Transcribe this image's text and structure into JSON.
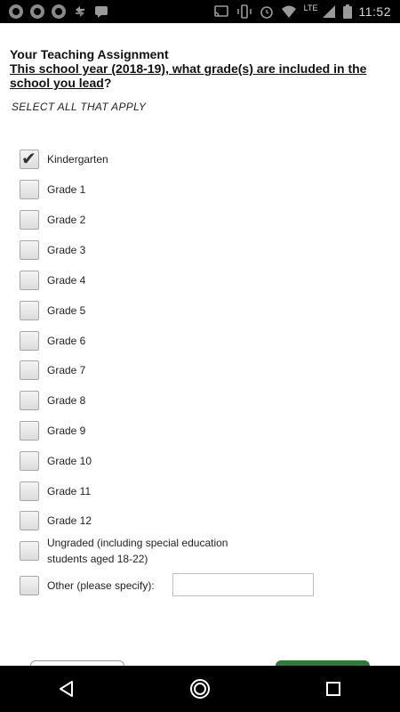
{
  "status_bar": {
    "network_label": "LTE",
    "time": "11:52"
  },
  "survey": {
    "section_title": "Your Teaching Assignment",
    "question_part1": "This school year (2018-19), what grade(s) are included in the school you lead",
    "question_mark": "?",
    "instruction": "SELECT ALL THAT APPLY",
    "options": [
      {
        "label": "Kindergarten",
        "checked": true
      },
      {
        "label": "Grade 1",
        "checked": false
      },
      {
        "label": "Grade 2",
        "checked": false
      },
      {
        "label": "Grade 3",
        "checked": false
      },
      {
        "label": "Grade 4",
        "checked": false
      },
      {
        "label": "Grade 5",
        "checked": false
      },
      {
        "label": "Grade 6",
        "checked": false
      },
      {
        "label": "Grade 7",
        "checked": false
      },
      {
        "label": "Grade 8",
        "checked": false
      },
      {
        "label": "Grade 9",
        "checked": false
      },
      {
        "label": "Grade 10",
        "checked": false
      },
      {
        "label": "Grade 11",
        "checked": false
      },
      {
        "label": "Grade 12",
        "checked": false
      },
      {
        "label": "Ungraded (including special education students aged 18-22)",
        "checked": false
      },
      {
        "label": "Other (please specify):",
        "checked": false
      }
    ],
    "other_specify_value": ""
  },
  "icons": {
    "status_left": [
      "notification-icon",
      "notification-icon",
      "notification-icon",
      "sync-icon",
      "message-icon"
    ],
    "status_right": [
      "cast-icon",
      "vibrate-icon",
      "alarm-icon",
      "wifi-icon",
      "signal-icon",
      "battery-icon"
    ],
    "nav": [
      "back-icon",
      "home-icon",
      "recents-icon"
    ]
  },
  "colors": {
    "status_bar": "#000000",
    "nav_bar": "#000000",
    "next_button": "#2f7a3a"
  }
}
